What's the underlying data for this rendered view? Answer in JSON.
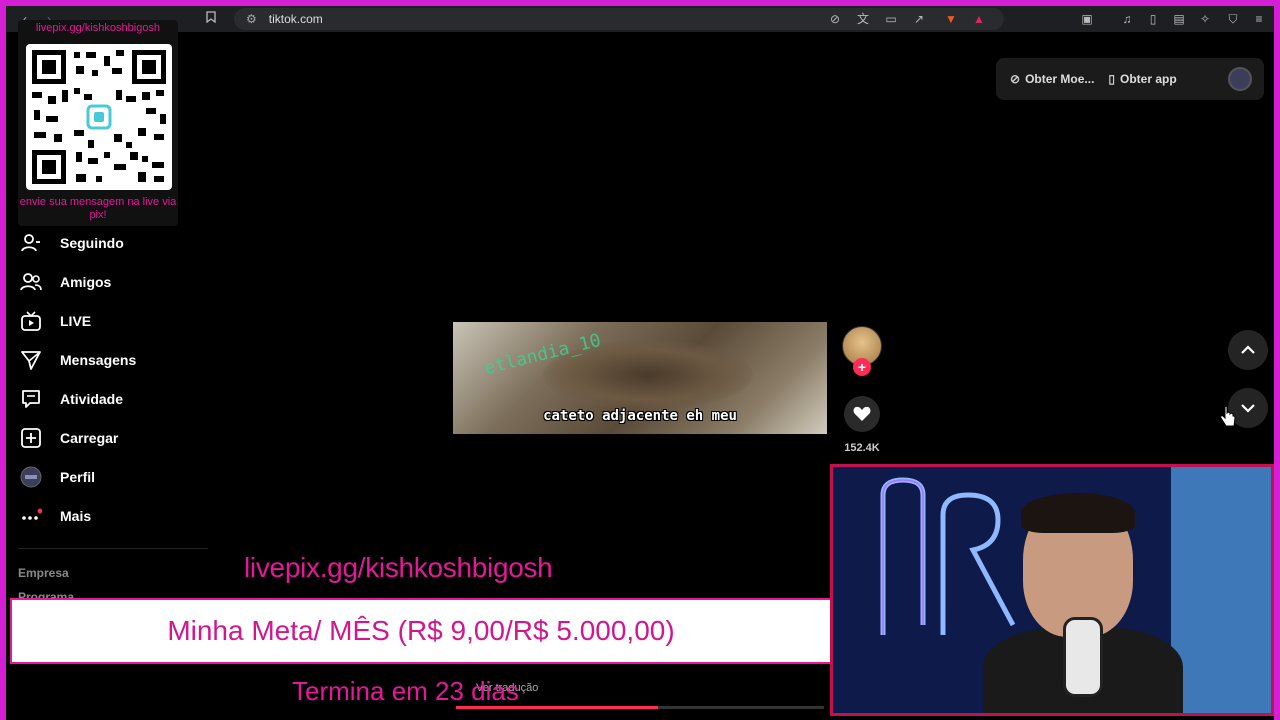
{
  "browser": {
    "url": "tiktok.com"
  },
  "qr_overlay": {
    "url_text": "livepix.gg/kishkoshbigosh",
    "message": "envie sua mensagem na live via pix!"
  },
  "sidebar": {
    "items": [
      {
        "label": "Seguindo",
        "icon": "person-icon"
      },
      {
        "label": "Amigos",
        "icon": "friends-icon"
      },
      {
        "label": "LIVE",
        "icon": "live-tv-icon"
      },
      {
        "label": "Mensagens",
        "icon": "messages-icon"
      },
      {
        "label": "Atividade",
        "icon": "activity-icon"
      },
      {
        "label": "Carregar",
        "icon": "upload-icon"
      },
      {
        "label": "Perfil",
        "icon": "avatar-icon"
      },
      {
        "label": "Mais",
        "icon": "more-icon"
      }
    ],
    "footer": [
      "Empresa",
      "Programa"
    ]
  },
  "header": {
    "coins_label": "Obter Moe...",
    "app_label": "Obter app"
  },
  "video": {
    "caption": "cateto adjacente eh meu",
    "watermark": "etlandia_10"
  },
  "actions": {
    "like_count": "152.4K"
  },
  "stream_overlay": {
    "pix_url": "livepix.gg/kishkoshbigosh",
    "goal": "Minha Meta/ MÊS (R$ 9,00/R$ 5.000,00)",
    "ends": "Termina em 23 dias",
    "translate_hint": "Ver tradução"
  },
  "playback": {
    "progress": 0.55
  },
  "colors": {
    "accent_pink": "#e5189a",
    "tiktok_red": "#fe2c55",
    "frame_magenta": "#d41fd4"
  }
}
